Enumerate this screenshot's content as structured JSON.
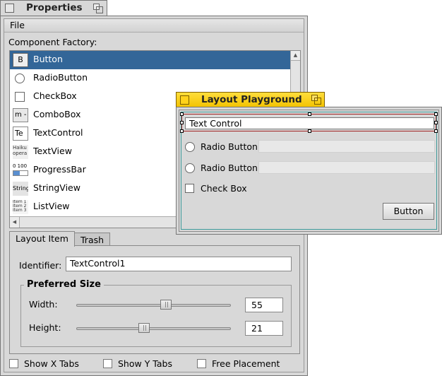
{
  "properties_window": {
    "title": "Properties",
    "menu": {
      "file": "File"
    },
    "factory_label": "Component Factory:",
    "components": [
      {
        "label": "Button",
        "icon": "button-icon",
        "icon_text": "B",
        "selected": true
      },
      {
        "label": "RadioButton",
        "icon": "radio-icon",
        "icon_text": ""
      },
      {
        "label": "CheckBox",
        "icon": "checkbox-icon",
        "icon_text": ""
      },
      {
        "label": "ComboBox",
        "icon": "combobox-icon",
        "icon_text": "m -"
      },
      {
        "label": "TextControl",
        "icon": "textcontrol-icon",
        "icon_text": "Te"
      },
      {
        "label": "TextView",
        "icon": "textview-icon",
        "icon_text": "Haiku opera"
      },
      {
        "label": "ProgressBar",
        "icon": "progressbar-icon",
        "icon_text": "0 100",
        "progress": 0.45
      },
      {
        "label": "StringView",
        "icon": "stringview-icon",
        "icon_text": "String"
      },
      {
        "label": "ListView",
        "icon": "listview-icon",
        "icon_text": "Item 1 Item 2 Item 3"
      }
    ],
    "tabs": [
      {
        "label": "Layout Item",
        "active": true
      },
      {
        "label": "Trash",
        "active": false
      }
    ],
    "identifier_label": "Identifier:",
    "identifier_value": "TextControl1",
    "preferred_size": {
      "title": "Preferred Size",
      "width_label": "Width:",
      "width_value": "55",
      "width_slider": 0.58,
      "height_label": "Height:",
      "height_value": "21",
      "height_slider": 0.43
    },
    "checkboxes": {
      "show_x_tabs": "Show X Tabs",
      "show_y_tabs": "Show Y Tabs",
      "free_placement": "Free Placement"
    }
  },
  "layout_playground": {
    "title": "Layout Playground",
    "text_control_value": "Text Control",
    "radio_1": "Radio Button",
    "radio_2": "Radio Button",
    "check_box": "Check Box",
    "button": "Button"
  },
  "colors": {
    "selection": "#336698",
    "playground_tab": "#f2c200",
    "layout_frame": "#3c9a9a",
    "selection_outline": "#a02020"
  }
}
